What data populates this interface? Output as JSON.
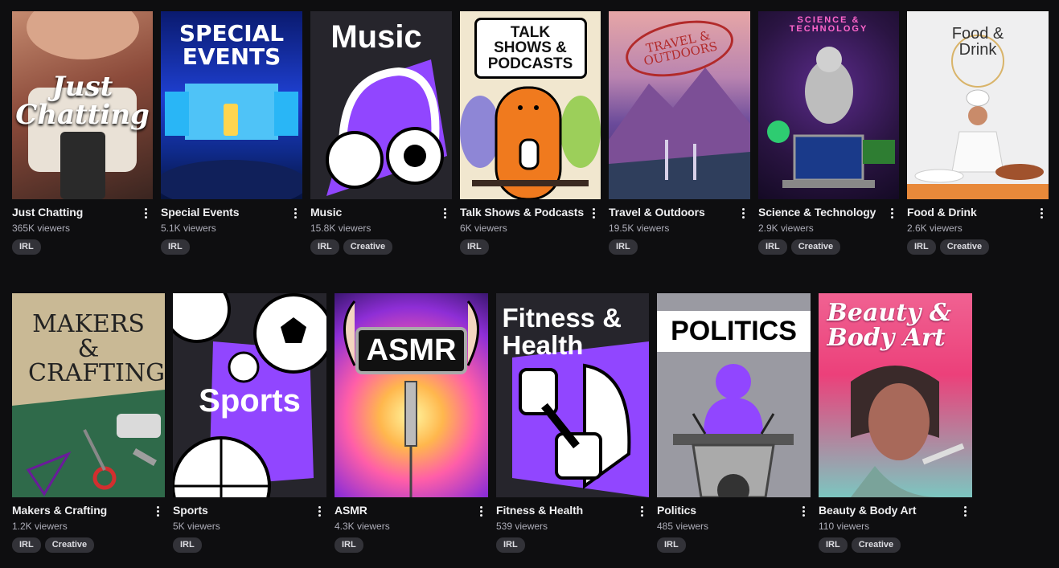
{
  "colors": {
    "background": "#0e0e10",
    "text": "#efeff1",
    "muted": "#adadb8",
    "tag_bg": "#323238",
    "accent": "#9146ff"
  },
  "categories": [
    {
      "name": "Just Chatting",
      "viewers": "365K viewers",
      "tags": [
        "IRL"
      ],
      "art_text": "Just Chatting",
      "art_icon": "coffee-mug-icon"
    },
    {
      "name": "Special Events",
      "viewers": "5.1K viewers",
      "tags": [
        "IRL"
      ],
      "art_text": "SPECIAL EVENTS",
      "art_icon": "stage-icon"
    },
    {
      "name": "Music",
      "viewers": "15.8K viewers",
      "tags": [
        "IRL",
        "Creative"
      ],
      "art_text": "Music",
      "art_icon": "headphones-icon"
    },
    {
      "name": "Talk Shows & Podcasts",
      "viewers": "6K viewers",
      "tags": [
        "IRL"
      ],
      "art_text": "TALK SHOWS & PODCASTS",
      "art_icon": "microphone-icon"
    },
    {
      "name": "Travel & Outdoors",
      "viewers": "19.5K viewers",
      "tags": [
        "IRL"
      ],
      "art_text": "TRAVEL & OUTDOORS",
      "art_icon": "mountain-icon"
    },
    {
      "name": "Science & Technology",
      "viewers": "2.9K viewers",
      "tags": [
        "IRL",
        "Creative"
      ],
      "art_text": "SCIENCE & TECHNOLOGY",
      "art_icon": "laptop-icon"
    },
    {
      "name": "Food & Drink",
      "viewers": "2.6K viewers",
      "tags": [
        "IRL",
        "Creative"
      ],
      "art_text": "Food & Drink",
      "art_icon": "chef-icon"
    },
    {
      "name": "Makers & Crafting",
      "viewers": "1.2K viewers",
      "tags": [
        "IRL",
        "Creative"
      ],
      "art_text": "MAKERS & CRAFTING",
      "art_icon": "scissors-icon"
    },
    {
      "name": "Sports",
      "viewers": "5K viewers",
      "tags": [
        "IRL"
      ],
      "art_text": "Sports",
      "art_icon": "soccer-ball-icon"
    },
    {
      "name": "ASMR",
      "viewers": "4.3K viewers",
      "tags": [
        "IRL"
      ],
      "art_text": "ASMR",
      "art_icon": "ear-icon"
    },
    {
      "name": "Fitness & Health",
      "viewers": "539 viewers",
      "tags": [
        "IRL"
      ],
      "art_text": "Fitness & Health",
      "art_icon": "dumbbell-icon"
    },
    {
      "name": "Politics",
      "viewers": "485 viewers",
      "tags": [
        "IRL"
      ],
      "art_text": "POLITICS",
      "art_icon": "podium-icon"
    },
    {
      "name": "Beauty & Body Art",
      "viewers": "110 viewers",
      "tags": [
        "IRL",
        "Creative"
      ],
      "art_text": "Beauty & Body Art",
      "art_icon": "makeup-brush-icon"
    }
  ]
}
